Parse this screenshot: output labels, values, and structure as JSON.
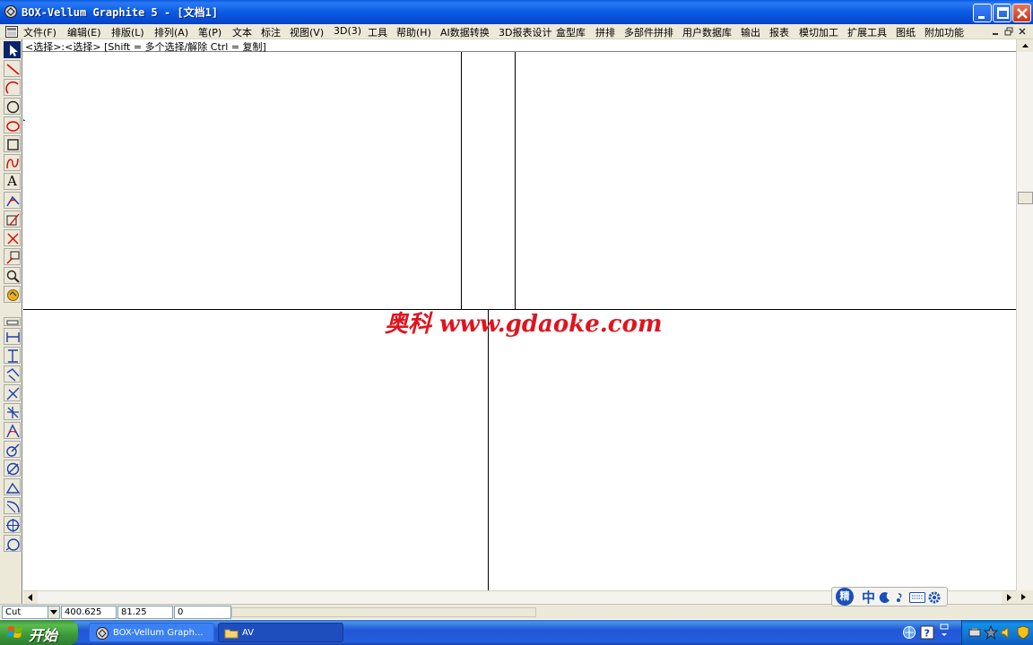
{
  "window": {
    "title": "BOX-Vellum Graphite 5 - [文档1]"
  },
  "menubar": {
    "items": [
      "文件(F)",
      "编辑(E)",
      "排版(L)",
      "排列(A)",
      "笔(P)",
      "文本",
      "标注",
      "视图(V)",
      "3D(3)",
      "工具",
      "帮助(H)",
      "AI数据转换",
      "3D报表设计",
      "盒型库",
      "拼排",
      "多部件拼排",
      "用户数据库",
      "输出",
      "报表",
      "模切加工",
      "扩展工具",
      "图纸",
      "附加功能"
    ]
  },
  "prompt": {
    "text": "<选择>:<选择> [Shift = 多个选择/解除 Ctrl = 复制]"
  },
  "toolbox": {
    "tools": [
      {
        "name": "select-tool-icon",
        "active": true
      },
      {
        "name": "line-tool-icon"
      },
      {
        "name": "arc-tool-icon"
      },
      {
        "name": "circle-tool-icon"
      },
      {
        "name": "ellipse-tool-icon"
      },
      {
        "name": "rectangle-tool-icon"
      },
      {
        "name": "curve-tool-icon"
      },
      {
        "name": "text-tool-icon",
        "glyph": "A"
      },
      {
        "name": "fillet-tool-icon"
      },
      {
        "name": "offset-tool-icon"
      },
      {
        "name": "trim-tool-icon"
      },
      {
        "name": "transform-tool-icon"
      },
      {
        "name": "zoom-tool-icon"
      },
      {
        "name": "pan-tool-icon"
      }
    ],
    "dim_tools": [
      {
        "name": "horizontal-dimension-icon"
      },
      {
        "name": "vertical-dimension-icon"
      },
      {
        "name": "aligned-dimension-icon"
      },
      {
        "name": "slanted-dimension-icon"
      },
      {
        "name": "angular-dimension-icon"
      },
      {
        "name": "angle-dimension-icon"
      },
      {
        "name": "radius-dimension-icon"
      },
      {
        "name": "diameter-dimension-icon"
      },
      {
        "name": "chamfer-dimension-icon"
      },
      {
        "name": "arc-length-dimension-icon"
      },
      {
        "name": "center-mark-icon"
      },
      {
        "name": "leader-dimension-icon"
      }
    ]
  },
  "canvas": {
    "watermark": "奥科 www.gdaoke.com"
  },
  "statusbar": {
    "mode": "Cut",
    "x": "400.625",
    "y": "81.25",
    "z": "0"
  },
  "ime": {
    "items": [
      "精",
      "中"
    ]
  },
  "taskbar": {
    "start_label": "开始",
    "buttons": [
      {
        "label": "BOX-Vellum Graph...",
        "active": false
      },
      {
        "label": "AV",
        "active": true
      }
    ]
  },
  "colors": {
    "watermark": "#e0141e",
    "titlebar": "#0b5be3",
    "taskbar": "#245edb",
    "start": "#3a9a3a"
  }
}
